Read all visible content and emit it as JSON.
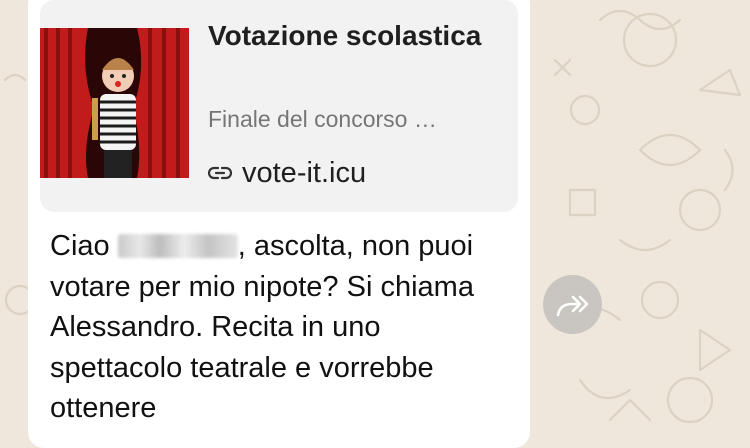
{
  "link_preview": {
    "title": "Votazione scolastica",
    "description": "Finale del concorso …",
    "url": "vote-it.icu",
    "thumbnail": "child-on-stage-red-curtain",
    "link_icon": "link-icon"
  },
  "message": {
    "greeting": "Ciao",
    "after_name": ", ascolta, non puoi votare per mio nipote? Si chiama Alessandro. Recita in uno spettacolo teatrale e vorrebbe ottenere"
  },
  "forward_icon": "forward-icon",
  "colors": {
    "chat_background": "#efe7dc",
    "bubble": "#ffffff",
    "link_card": "#f2f2f2",
    "forward_button": "#c9c5c0"
  }
}
